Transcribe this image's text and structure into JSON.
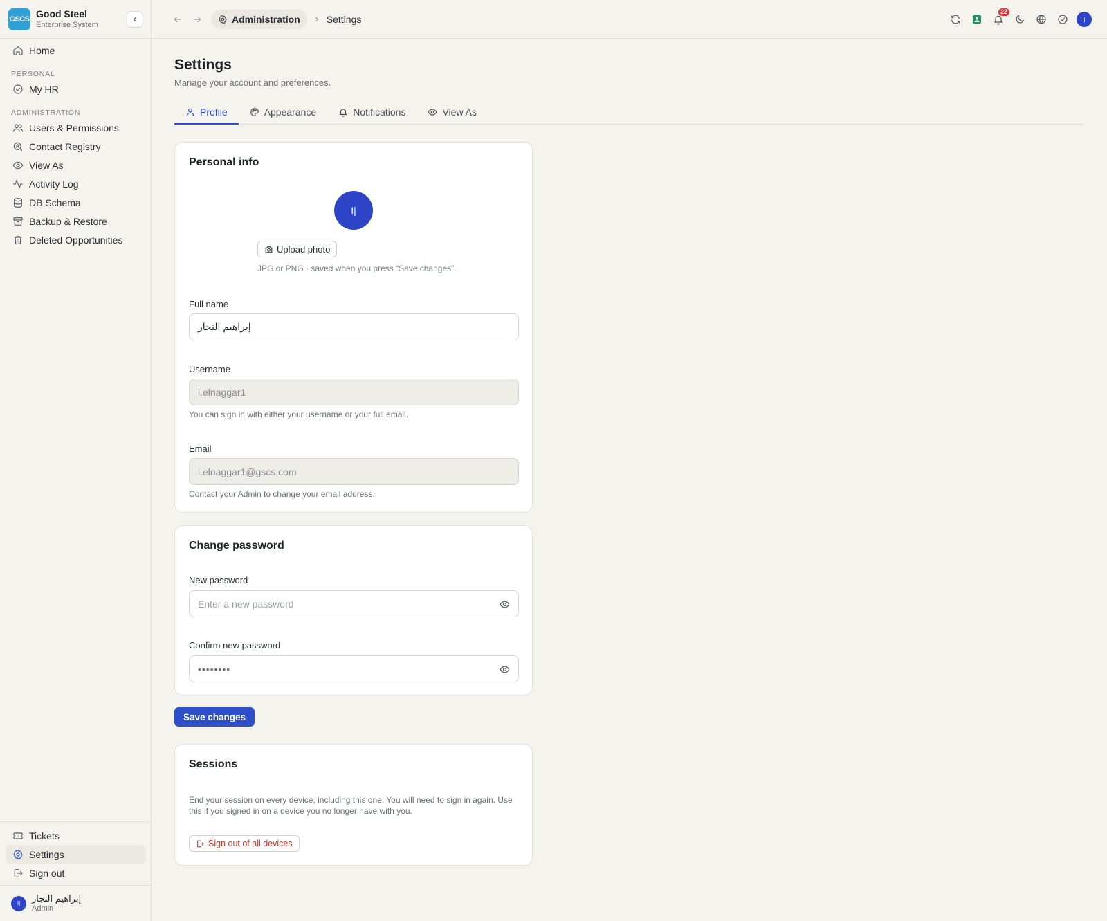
{
  "brand": {
    "logo_text": "GSCS",
    "name": "Good Steel",
    "subtitle": "Enterprise System"
  },
  "sidebar": {
    "home": "Home",
    "personal_section": "PERSONAL",
    "personal_items": [
      {
        "label": "My HR",
        "icon": "check-circle-icon"
      }
    ],
    "admin_section": "ADMINISTRATION",
    "admin_items": [
      {
        "label": "Users & Permissions",
        "icon": "users-icon"
      },
      {
        "label": "Contact Registry",
        "icon": "search-contact-icon"
      },
      {
        "label": "View As",
        "icon": "eye-icon"
      },
      {
        "label": "Activity Log",
        "icon": "activity-icon"
      },
      {
        "label": "DB Schema",
        "icon": "database-icon"
      },
      {
        "label": "Backup & Restore",
        "icon": "archive-icon"
      },
      {
        "label": "Deleted Opportunities",
        "icon": "trash-icon"
      }
    ],
    "bottom_items": [
      {
        "label": "Tickets",
        "icon": "ticket-icon"
      },
      {
        "label": "Settings",
        "icon": "gear-icon"
      },
      {
        "label": "Sign out",
        "icon": "sign-out-icon"
      }
    ],
    "user": {
      "initials": "I|",
      "name": "إبراهيم النجار",
      "role": "Admin"
    }
  },
  "topbar": {
    "breadcrumb_parent": "Administration",
    "breadcrumb_current": "Settings",
    "notification_count": "22",
    "avatar_initials": "I|"
  },
  "page": {
    "title": "Settings",
    "subtitle": "Manage your account and preferences.",
    "tabs": [
      {
        "label": "Profile",
        "icon": "user-icon",
        "active": true
      },
      {
        "label": "Appearance",
        "icon": "palette-icon"
      },
      {
        "label": "Notifications",
        "icon": "bell-icon"
      },
      {
        "label": "View As",
        "icon": "eye-icon"
      }
    ]
  },
  "personal_info": {
    "title": "Personal info",
    "avatar_initials": "I|",
    "upload_label": "Upload photo",
    "upload_help": "JPG or PNG · saved when you press “Save changes”.",
    "full_name_label": "Full name",
    "full_name_value": "إبراهيم النجار",
    "username_label": "Username",
    "username_value": "i.elnaggar1",
    "username_help": "You can sign in with either your username or your full email.",
    "email_label": "Email",
    "email_value": "i.elnaggar1@gscs.com",
    "email_help": "Contact your Admin to change your email address."
  },
  "change_password": {
    "title": "Change password",
    "new_label": "New password",
    "new_placeholder": "Enter a new password",
    "confirm_label": "Confirm new password",
    "confirm_value": "••••••••"
  },
  "save_label": "Save changes",
  "sessions": {
    "title": "Sessions",
    "description": "End your session on every device, including this one. You will need to sign in again. Use this if you signed in on a device you no longer have with you.",
    "sign_out_all_label": "Sign out of all devices"
  },
  "colors": {
    "accent": "#2d4fc7",
    "avatar": "#2d44c6",
    "danger": "#c0392b",
    "badge": "#d9333a"
  }
}
